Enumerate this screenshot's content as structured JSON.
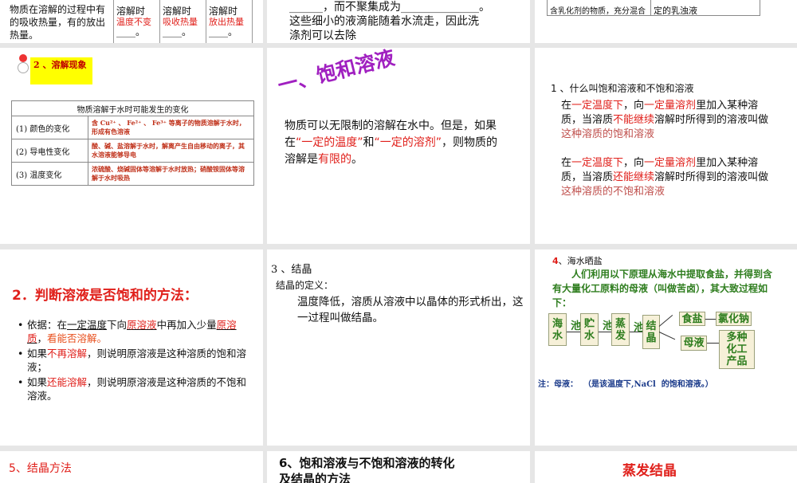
{
  "slides": {
    "s1": {
      "text": "物质在溶解的过程中有的吸收热量，有的放出热量。",
      "col1_head": "溶解时",
      "col1_ans": "温度不变",
      "col2_head": "溶解时",
      "col2_ans": "吸收热量",
      "col3_head": "溶解时",
      "col3_ans": "放出热量",
      "blank": "____。"
    },
    "s2": {
      "line1": "______，而不聚集成为______________。",
      "line2": "这些细小的液滴能随着水流走，因此洗",
      "line3": "涤剂可以去除"
    },
    "s3": {
      "cell1": "含乳化剂的物质，充分混合",
      "cell2": "定的乳浊液"
    },
    "s4": {
      "badge": "2 、溶解现象",
      "table_title": "物质溶解于水时可能发生的变化",
      "rows": [
        {
          "label": "(1) 颜色的变化",
          "desc": "含 Cu²⁺ 、 Fe²⁺ 、 Fe³⁺ 等离子的物质溶解于水时，形成有色溶液"
        },
        {
          "label": "(2) 导电性变化",
          "desc": "酸、碱、盐溶解于水时，解离产生自由移动的离子，其水溶液能够导电"
        },
        {
          "label": "(3) 温度变化",
          "desc": "浓硫酸、烧碱固体等溶解于水时放热；硝酸铵固体等溶解于水时吸热"
        }
      ]
    },
    "s5": {
      "title": "一、饱和溶液",
      "p1": "物质可以无限制的溶解在水中。但是，如果在",
      "q1": "“一定的温度”",
      "p2": "和",
      "q2": "“一定的溶剂”",
      "p3": "，则物质的溶解是",
      "r": "有限的",
      "p4": "。"
    },
    "s6": {
      "heading": "1 、什么叫饱和溶液和不饱和溶液",
      "a1": "在",
      "a2": "一定温度下",
      "a3": "，向",
      "a4": "一定量溶剂",
      "a5": "里加入某种溶质，当溶质",
      "a6": "不能继续",
      "a7": "溶解时所得到的溶液叫做",
      "a8": "这种溶质的饱和溶液",
      "b6": "还能继续",
      "b8": "这种溶质的不饱和溶液"
    },
    "s7": {
      "title": "2．判断溶液是否饱和的方法：",
      "b1a": "依据：在",
      "b1b": "一定温度",
      "b1c": "下向",
      "b1d": "原溶液",
      "b1e": "中再加入少量",
      "b1f": "原溶质",
      "b1g": "，",
      "b1h": "看能否溶解。",
      "b2a": "如果",
      "b2b": "不再溶解",
      "b2c": "，则说明原溶液是这种溶质的饱和溶液；",
      "b3a": "如果",
      "b3b": "还能溶解",
      "b3c": "，则说明原溶液是这种溶质的不饱和溶液。"
    },
    "s8": {
      "heading": "3 、结晶",
      "sub": "结晶的定义：",
      "body": "温度降低，溶质从溶液中以晶体的形式析出，这一过程叫做结晶。"
    },
    "s9": {
      "num": "4",
      "heading": "、海水晒盐",
      "body": "人们利用以下原理从海水中提取食盐，并得到含有大量化工原料的母液（叫做苦卤），其大致过程如下：",
      "flow": {
        "b1": "海水",
        "l1": "池",
        "b2": "贮水",
        "l2": "池",
        "b3": "蒸发",
        "l3": "池",
        "b4": "结晶",
        "salt": "食盐",
        "nacl": "氯化钠",
        "mother": "母液",
        "products": "多种化工产品"
      },
      "note": "注：母液：  （是该温度下,NaCl  的饱和溶液。）"
    },
    "s10": {
      "title": "5、结晶方法"
    },
    "s11": {
      "title": "6、饱和溶液与不饱和溶液的转化",
      "title2": "及结晶的方法"
    },
    "s12": {
      "title": "蒸发结晶"
    }
  }
}
